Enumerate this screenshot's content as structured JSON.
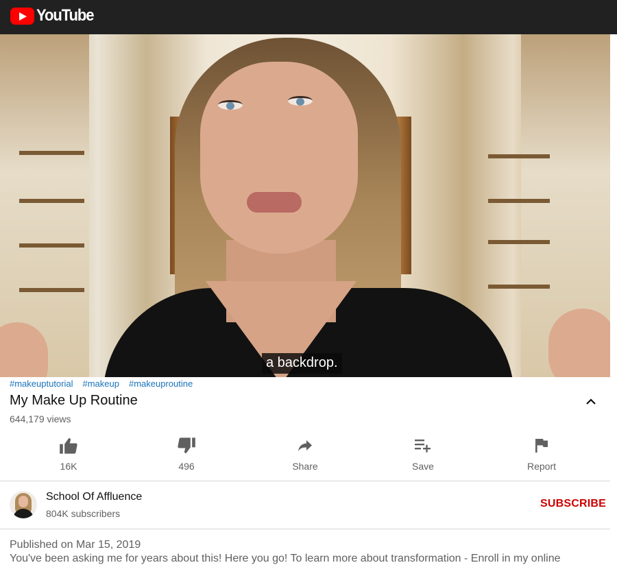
{
  "header": {
    "logo_text": "YouTube",
    "logo_color": "#ff0000",
    "background": "#212121"
  },
  "player": {
    "caption": "a backdrop."
  },
  "video": {
    "hashtags": [
      "#makeuptutorial",
      "#makeup",
      "#makeuproutine"
    ],
    "title": "My Make Up Routine",
    "views": "644,179 views"
  },
  "actions": {
    "like_count": "16K",
    "dislike_count": "496",
    "share_label": "Share",
    "save_label": "Save",
    "report_label": "Report"
  },
  "channel": {
    "name": "School Of Affluence",
    "subscribers": "804K subscribers",
    "subscribe_label": "SUBSCRIBE",
    "subscribe_color": "#cc0000"
  },
  "description": {
    "published": "Published on Mar 15, 2019",
    "text": "You've been asking me for years about this! Here you go! To learn more about transformation - Enroll in my online"
  }
}
